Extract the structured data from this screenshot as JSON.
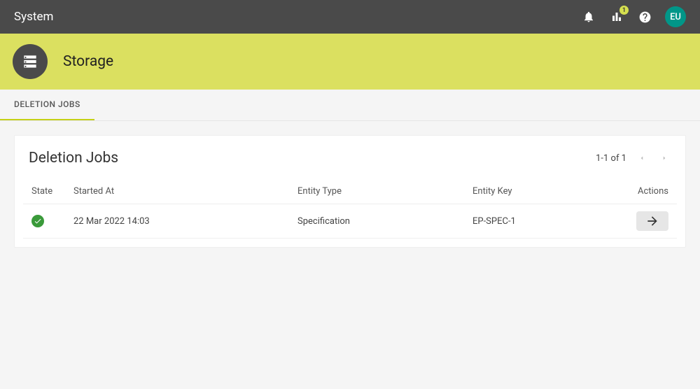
{
  "topnav": {
    "title": "System",
    "badge_count": "1",
    "avatar": "EU"
  },
  "hero": {
    "title": "Storage"
  },
  "tabs": [
    {
      "label": "DELETION JOBS",
      "active": true
    }
  ],
  "card": {
    "title": "Deletion Jobs",
    "pagination": "1-1 of 1",
    "columns": {
      "state": "State",
      "started_at": "Started At",
      "entity_type": "Entity Type",
      "entity_key": "Entity Key",
      "actions": "Actions"
    },
    "rows": [
      {
        "state": "complete",
        "started_at": "22 Mar 2022 14:03",
        "entity_type": "Specification",
        "entity_key": "EP-SPEC-1"
      }
    ]
  }
}
